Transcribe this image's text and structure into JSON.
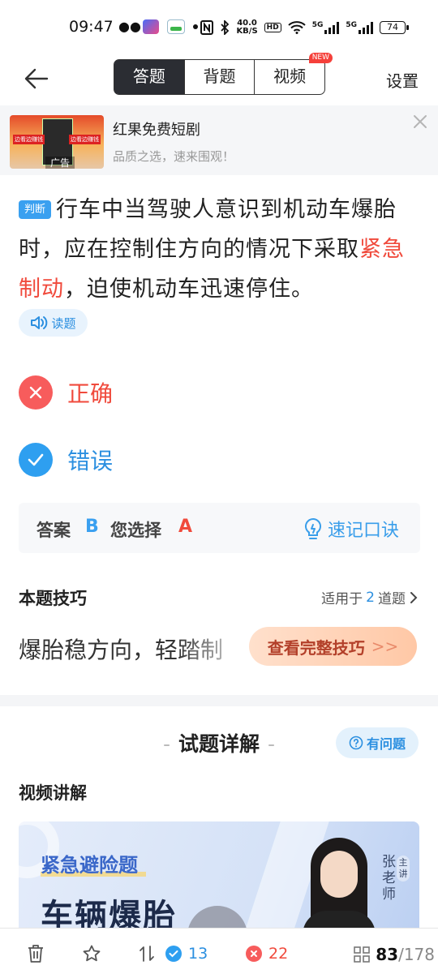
{
  "status_bar": {
    "time": "09:47",
    "net_speed_value": "40.0",
    "net_speed_unit": "KB/S",
    "hd": "HD",
    "sig1_label": "5G",
    "sig2_label": "5G",
    "battery": "74"
  },
  "nav": {
    "tabs": [
      "答题",
      "背题",
      "视频"
    ],
    "new_badge": "NEW",
    "settings_label": "设置"
  },
  "ad": {
    "title": "红果免费短剧",
    "subtitle": "品质之选，速来围观！",
    "tag": "广告",
    "thumb_left_text": "边看边赚钱",
    "thumb_right_text": "边看边赚钱"
  },
  "question": {
    "type_label": "判断",
    "text_before": "行车中当驾驶人意识到机动车爆胎时，应在控制住方向的情况下采取",
    "text_highlight": "紧急制动",
    "text_after": "，迫使机动车迅速停住。",
    "read_label": "读题"
  },
  "options": [
    {
      "label": "正确",
      "state": "wrong-selected"
    },
    {
      "label": "错误",
      "state": "correct"
    }
  ],
  "answer": {
    "answer_label": "答案",
    "answer_value": "B",
    "choice_label": "您选择",
    "choice_value": "A",
    "memo_label": "速记口诀"
  },
  "tips": {
    "title": "本题技巧",
    "applies_prefix": "适用于",
    "applies_count": "2",
    "applies_suffix": "道题",
    "content": "爆胎稳方向，轻踏制",
    "button_label": "查看完整技巧",
    "button_arrows": ">>"
  },
  "explanation": {
    "title": "试题详解",
    "dash": "-",
    "ask_label": "有问题",
    "video_section": "视频讲解",
    "video_tag": "紧急避险题",
    "video_big": "车辆爆胎",
    "teacher_name": "张老师",
    "teacher_role": "主讲"
  },
  "bottom_bar": {
    "correct_count": "13",
    "wrong_count": "22",
    "current": "83",
    "total": "/178"
  },
  "colors": {
    "accent_blue": "#2b8fe0",
    "error_red": "#f04a3c",
    "correct_blue": "#2e9ff0",
    "wrong_red": "#f75c5c"
  }
}
